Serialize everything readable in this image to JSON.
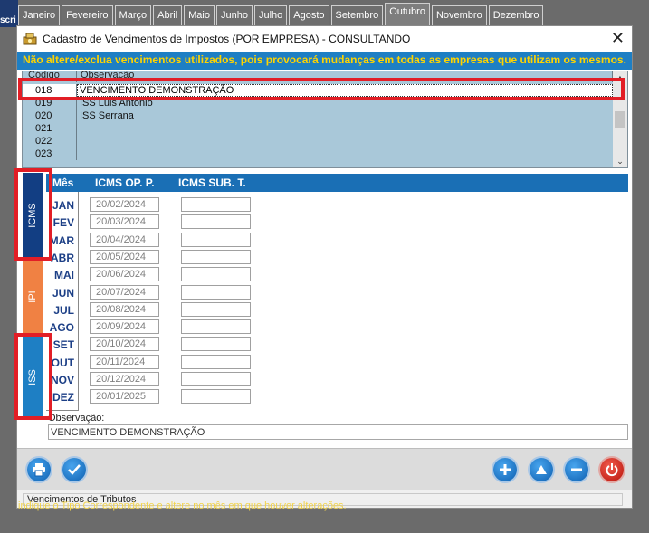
{
  "background": {
    "edge_text": "scri",
    "months": [
      {
        "label": "Janeiro",
        "active": false
      },
      {
        "label": "Fevereiro",
        "active": false
      },
      {
        "label": "Março",
        "active": false
      },
      {
        "label": "Abril",
        "active": false
      },
      {
        "label": "Maio",
        "active": false
      },
      {
        "label": "Junho",
        "active": false
      },
      {
        "label": "Julho",
        "active": false
      },
      {
        "label": "Agosto",
        "active": false
      },
      {
        "label": "Setembro",
        "active": false
      },
      {
        "label": "Outubro",
        "active": true
      },
      {
        "label": "Novembro",
        "active": false
      },
      {
        "label": "Dezembro",
        "active": false
      }
    ],
    "hint": "indique o Tipo Correspondente e altere no mês em que houver alterações."
  },
  "dialog": {
    "title": "Cadastro de Vencimentos de Impostos  (POR EMPRESA)   -   CONSULTANDO",
    "close_glyph": "✕",
    "warning": "Não altere/exclua vencimentos utilizados, pois provocará mudanças em todas as empresas que utilizam os mesmos.",
    "grid": {
      "columns": {
        "codigo": "Código",
        "observacao": "Observação"
      },
      "rows": [
        {
          "codigo": "018",
          "obs": "VENCIMENTO DEMONSTRAÇÃO",
          "selected": true
        },
        {
          "codigo": "019",
          "obs": "ISS Luis Antonio",
          "selected": false
        },
        {
          "codigo": "020",
          "obs": "ISS Serrana",
          "selected": false
        },
        {
          "codigo": "021",
          "obs": "",
          "selected": false
        },
        {
          "codigo": "022",
          "obs": "",
          "selected": false
        },
        {
          "codigo": "023",
          "obs": "",
          "selected": false
        }
      ]
    },
    "tabs": {
      "icms": "ICMS",
      "ipi": "IPI",
      "iss": "ISS",
      "active": "ICMS"
    },
    "table": {
      "headers": {
        "mes": "Mês",
        "op": "ICMS OP. P.",
        "sub": "ICMS SUB. T."
      },
      "rows": [
        {
          "mes": "JAN",
          "op": "20/02/2024",
          "sub": ""
        },
        {
          "mes": "FEV",
          "op": "20/03/2024",
          "sub": ""
        },
        {
          "mes": "MAR",
          "op": "20/04/2024",
          "sub": ""
        },
        {
          "mes": "ABR",
          "op": "20/05/2024",
          "sub": ""
        },
        {
          "mes": "MAI",
          "op": "20/06/2024",
          "sub": ""
        },
        {
          "mes": "JUN",
          "op": "20/07/2024",
          "sub": ""
        },
        {
          "mes": "JUL",
          "op": "20/08/2024",
          "sub": ""
        },
        {
          "mes": "AGO",
          "op": "20/09/2024",
          "sub": ""
        },
        {
          "mes": "SET",
          "op": "20/10/2024",
          "sub": ""
        },
        {
          "mes": "OUT",
          "op": "20/11/2024",
          "sub": ""
        },
        {
          "mes": "NOV",
          "op": "20/12/2024",
          "sub": ""
        },
        {
          "mes": "DEZ",
          "op": "20/01/2025",
          "sub": ""
        }
      ]
    },
    "observacao": {
      "label": "Observação:",
      "value": "VENCIMENTO DEMONSTRAÇÃO"
    },
    "toolbar": {
      "left_icons": [
        "printer-icon",
        "check-icon"
      ],
      "right_icons": [
        "plus-icon",
        "up-arrow-icon",
        "minus-icon",
        "power-icon"
      ]
    },
    "status": "Vencimentos de Tributos"
  },
  "colors": {
    "warning_bg": "#1e7fc4",
    "warning_text": "#ffd400",
    "highlight": "#e21e26",
    "icms_tab": "#123e83",
    "ipi_tab": "#f08143",
    "iss_tab": "#1e7fc4",
    "grid_bg": "#a9c8d9"
  }
}
